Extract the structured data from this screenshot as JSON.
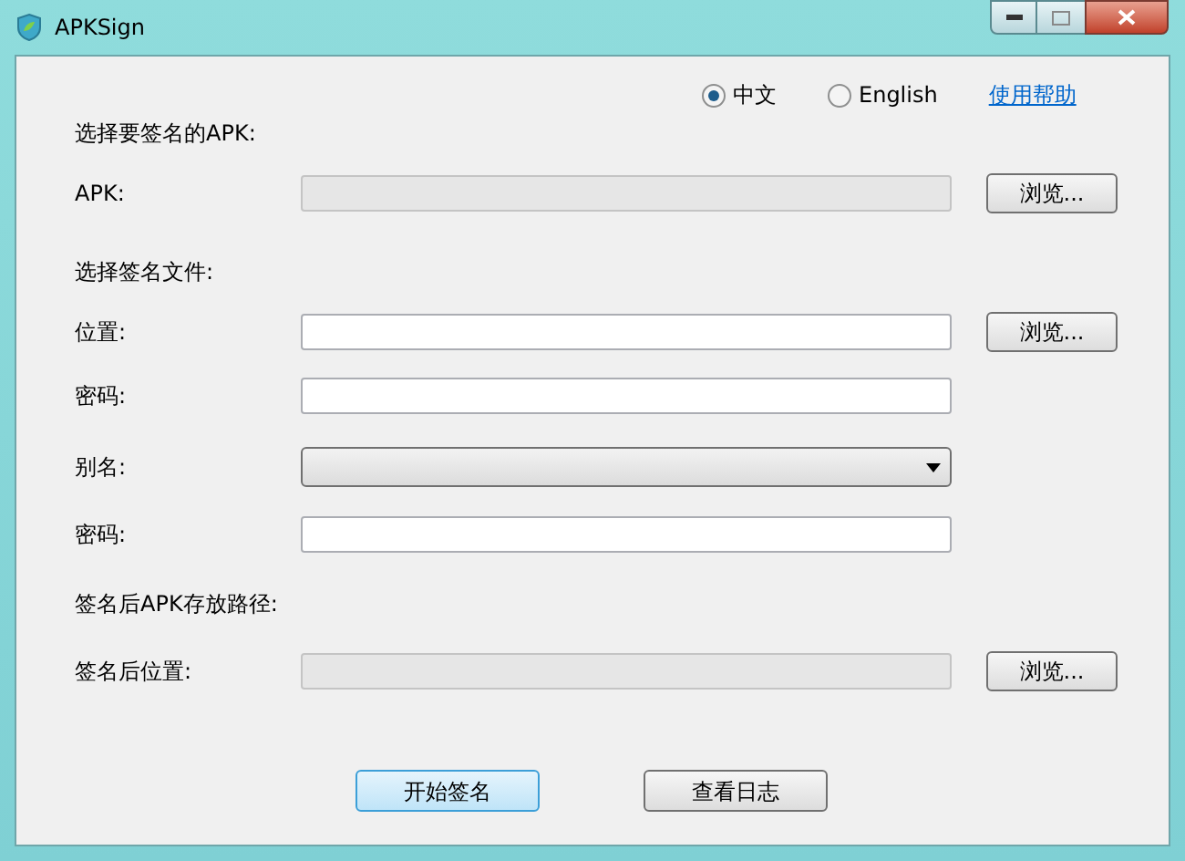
{
  "window": {
    "title": "APKSign"
  },
  "languages": [
    {
      "label": "中文",
      "selected": true
    },
    {
      "label": "English",
      "selected": false
    }
  ],
  "help_link": "使用帮助",
  "rows": [
    {
      "kind": "section",
      "label": "选择要签名的APK:"
    },
    {
      "kind": "field",
      "label": "APK:",
      "disabled": true,
      "button": "浏览..."
    },
    {
      "kind": "section",
      "label": "选择签名文件:"
    },
    {
      "kind": "field",
      "label": "位置:",
      "disabled": false,
      "button": "浏览..."
    },
    {
      "kind": "field",
      "label": "密码:",
      "disabled": false
    },
    {
      "kind": "combo",
      "label": "别名:"
    },
    {
      "kind": "field",
      "label": "密码:",
      "disabled": false
    },
    {
      "kind": "section",
      "label": "签名后APK存放路径:"
    },
    {
      "kind": "field",
      "label": "签名后位置:",
      "disabled": true,
      "button": "浏览..."
    }
  ],
  "actions": [
    {
      "label": "开始签名",
      "selected": true
    },
    {
      "label": "查看日志",
      "selected": false
    }
  ]
}
